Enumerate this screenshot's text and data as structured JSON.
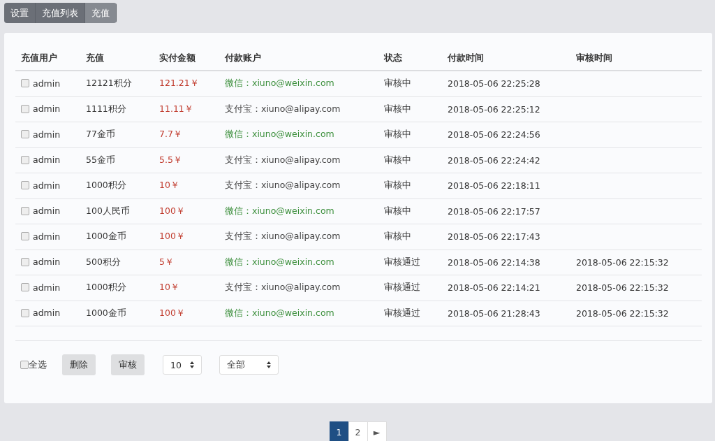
{
  "tabs": [
    {
      "label": "设置",
      "selected": false
    },
    {
      "label": "充值列表",
      "selected": false
    },
    {
      "label": "充值",
      "selected": true
    }
  ],
  "table": {
    "columns": [
      "充值用户",
      "充值",
      "实付金额",
      "付款账户",
      "状态",
      "付款时间",
      "审核时间"
    ],
    "rows": [
      {
        "checked": false,
        "user": "admin",
        "recharge": "12121积分",
        "paid": "121.21￥",
        "account": "微信：xiuno@weixin.com",
        "kind": "wechat",
        "status": "审核中",
        "pay_time": "2018-05-06 22:25:28"
      },
      {
        "checked": false,
        "user": "admin",
        "recharge": "1111积分",
        "paid": "11.11￥",
        "account": "支付宝：xiuno@alipay.com",
        "kind": "alipay",
        "status": "审核中",
        "pay_time": "2018-05-06 22:25:12"
      },
      {
        "checked": false,
        "user": "admin",
        "recharge": "77金币",
        "paid": "7.7￥",
        "account": "微信：xiuno@weixin.com",
        "kind": "wechat",
        "status": "审核中",
        "pay_time": "2018-05-06 22:24:56"
      },
      {
        "checked": false,
        "user": "admin",
        "recharge": "55金币",
        "paid": "5.5￥",
        "account": "支付宝：xiuno@alipay.com",
        "kind": "alipay",
        "status": "审核中",
        "pay_time": "2018-05-06 22:24:42"
      },
      {
        "checked": false,
        "user": "admin",
        "recharge": "1000积分",
        "paid": "10￥",
        "account": "支付宝：xiuno@alipay.com",
        "kind": "alipay",
        "status": "审核中",
        "pay_time": "2018-05-06 22:18:11"
      },
      {
        "checked": false,
        "user": "admin",
        "recharge": "100人民币",
        "paid": "100￥",
        "account": "微信：xiuno@weixin.com",
        "kind": "wechat",
        "status": "审核中",
        "pay_time": "2018-05-06 22:17:57"
      },
      {
        "checked": false,
        "user": "admin",
        "recharge": "1000金币",
        "paid": "100￥",
        "account": "支付宝：xiuno@alipay.com",
        "kind": "alipay",
        "status": "审核中",
        "pay_time": "2018-05-06 22:17:43"
      },
      {
        "checked": false,
        "user": "admin",
        "recharge": "500积分",
        "paid": "5￥",
        "account": "微信：xiuno@weixin.com",
        "kind": "wechat",
        "status": "审核通过",
        "pay_time": "2018-05-06 22:14:38",
        "review_time": "2018-05-06 22:15:32"
      },
      {
        "checked": false,
        "user": "admin",
        "recharge": "1000积分",
        "paid": "10￥",
        "account": "支付宝：xiuno@alipay.com",
        "kind": "alipay",
        "status": "审核通过",
        "pay_time": "2018-05-06 22:14:21",
        "review_time": "2018-05-06 22:15:32"
      },
      {
        "checked": false,
        "user": "admin",
        "recharge": "1000金币",
        "paid": "100￥",
        "account": "微信：xiuno@weixin.com",
        "kind": "wechat",
        "status": "审核通过",
        "pay_time": "2018-05-06 21:28:43",
        "review_time": "2018-05-06 22:15:32"
      }
    ]
  },
  "footer": {
    "select_all": {
      "label": "全选",
      "checked": false
    },
    "buttons": [
      "删除",
      "审核"
    ],
    "page_size": "10",
    "filter": "全部"
  },
  "pagination": [
    {
      "label": "1",
      "selected": true
    },
    {
      "label": "2",
      "selected": false
    },
    {
      "label": "►",
      "selected": false
    }
  ]
}
